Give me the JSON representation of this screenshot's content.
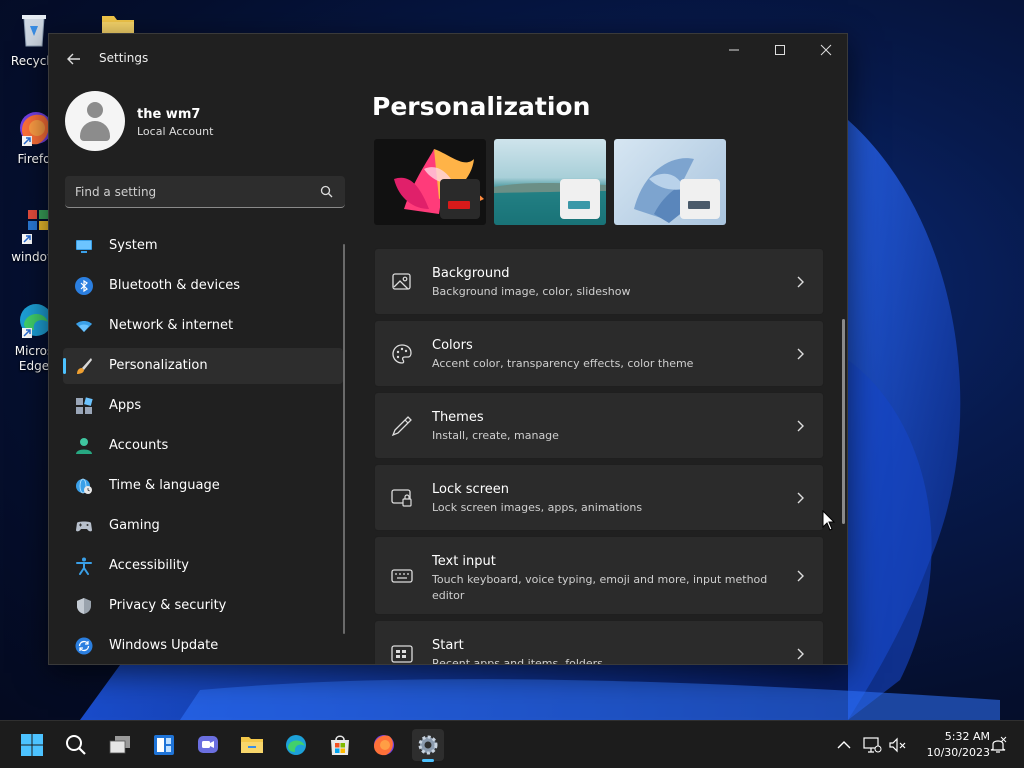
{
  "desktop": {
    "icons": [
      {
        "label": "Recycle"
      },
      {
        "label": "Firefo"
      },
      {
        "label": "window"
      },
      {
        "label": "Micros Edge"
      }
    ]
  },
  "window": {
    "title": "Settings",
    "profile": {
      "name": "the wm7",
      "type": "Local Account"
    },
    "search": {
      "placeholder": "Find a setting"
    },
    "nav": [
      {
        "label": "System",
        "icon": "monitor-icon"
      },
      {
        "label": "Bluetooth & devices",
        "icon": "bluetooth-icon"
      },
      {
        "label": "Network & internet",
        "icon": "wifi-icon"
      },
      {
        "label": "Personalization",
        "icon": "brush-icon",
        "active": true
      },
      {
        "label": "Apps",
        "icon": "apps-icon"
      },
      {
        "label": "Accounts",
        "icon": "person-icon"
      },
      {
        "label": "Time & language",
        "icon": "globe-clock-icon"
      },
      {
        "label": "Gaming",
        "icon": "gamepad-icon"
      },
      {
        "label": "Accessibility",
        "icon": "accessibility-icon"
      },
      {
        "label": "Privacy & security",
        "icon": "shield-icon"
      },
      {
        "label": "Windows Update",
        "icon": "update-icon"
      }
    ],
    "main": {
      "title": "Personalization",
      "cards": [
        {
          "title": "Background",
          "subtitle": "Background image, color, slideshow",
          "icon": "image-icon"
        },
        {
          "title": "Colors",
          "subtitle": "Accent color, transparency effects, color theme",
          "icon": "palette-icon"
        },
        {
          "title": "Themes",
          "subtitle": "Install, create, manage",
          "icon": "pen-icon"
        },
        {
          "title": "Lock screen",
          "subtitle": "Lock screen images, apps, animations",
          "icon": "lock-screen-icon"
        },
        {
          "title": "Text input",
          "subtitle": "Touch keyboard, voice typing, emoji and more, input method editor",
          "icon": "keyboard-icon"
        },
        {
          "title": "Start",
          "subtitle": "Recent apps and items, folders",
          "icon": "start-icon"
        }
      ]
    }
  },
  "taskbar": {
    "time": "5:32 AM",
    "date": "10/30/2023"
  },
  "colors": {
    "accent": "#4cc2ff",
    "window_bg": "#202020",
    "card_bg": "#2b2b2b"
  }
}
